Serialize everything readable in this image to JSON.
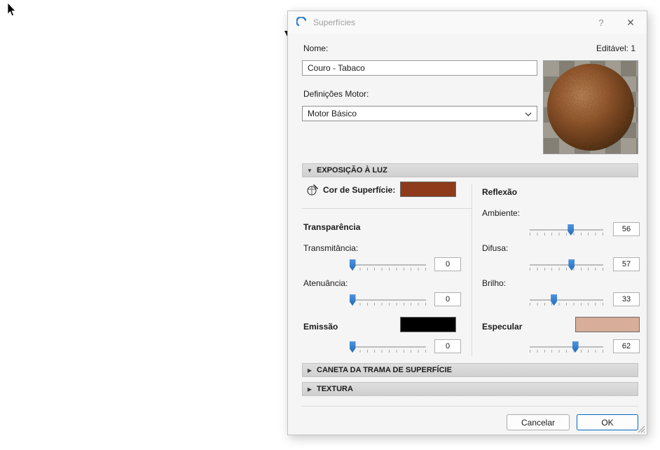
{
  "dialog": {
    "title": "Superfícies",
    "titlebar": {
      "help": "?",
      "close": "✕"
    },
    "header": {
      "name_label": "Nome:",
      "editable": "Editável: 1",
      "name_value": "Couro - Tabaco",
      "engine_label": "Definições Motor:",
      "engine_value": "Motor Básico"
    },
    "sections": {
      "light_exposure": {
        "label": "EXPOSIÇÃO À LUZ",
        "arrow": "▼"
      },
      "pen": {
        "label": "CANETA DA TRAMA DE SUPERFÍCIE",
        "arrow": "▶"
      },
      "texture": {
        "label": "TEXTURA",
        "arrow": "▶"
      }
    },
    "light": {
      "surface_color_label": "Cor de Superfície:",
      "transparency_title": "Transparência",
      "reflection_title": "Reflexão",
      "emission_label": "Emissão",
      "specular_label": "Especular",
      "sliders": {
        "transmittance": {
          "label": "Transmitância:",
          "value": "0",
          "pct": 0
        },
        "attenuation": {
          "label": "Atenuância:",
          "value": "0",
          "pct": 0
        },
        "emission": {
          "value": "0",
          "pct": 0
        },
        "ambient": {
          "label": "Ambiente:",
          "value": "56",
          "pct": 56
        },
        "diffuse": {
          "label": "Difusa:",
          "value": "57",
          "pct": 57
        },
        "shine": {
          "label": "Brilho:",
          "value": "33",
          "pct": 33
        },
        "specular": {
          "value": "62",
          "pct": 62
        }
      },
      "colors": {
        "surface": "#8e3a1b",
        "emission": "#000000",
        "specular": "#d8ae9a"
      }
    },
    "footer": {
      "cancel": "Cancelar",
      "ok": "OK"
    }
  }
}
